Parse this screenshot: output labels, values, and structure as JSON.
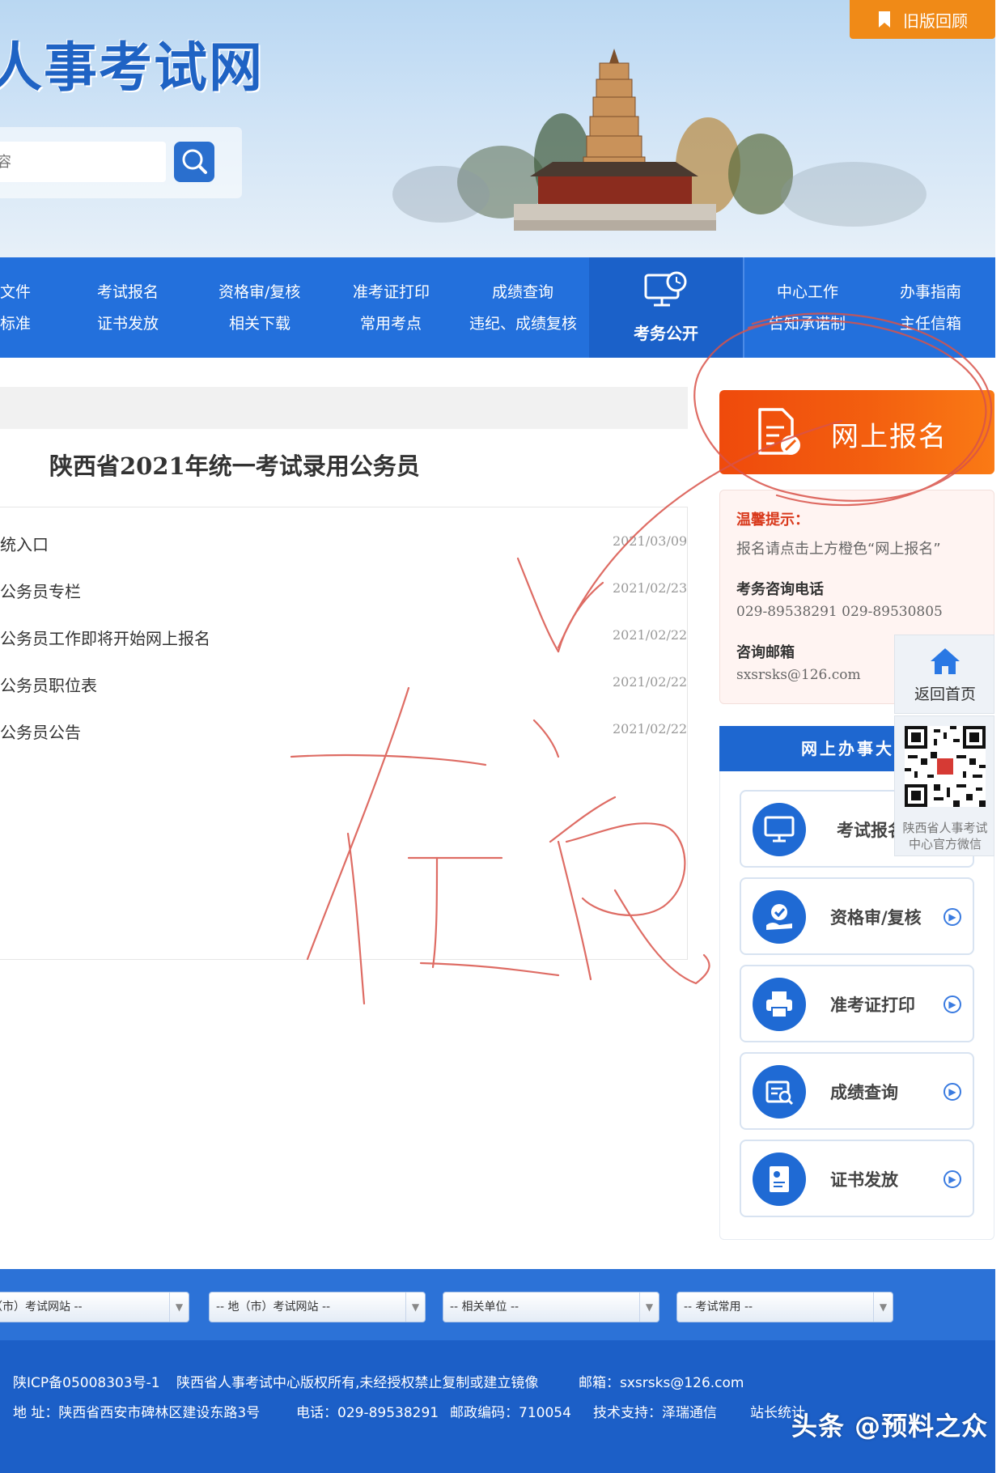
{
  "header": {
    "site_title": "人事考试网",
    "search_placeholder": "容",
    "old_version_label": "旧版回顾"
  },
  "nav": {
    "col1": [
      "文件",
      "标准"
    ],
    "col2": [
      "考试报名",
      "证书发放"
    ],
    "col3": [
      "资格审/复核",
      "相关下载"
    ],
    "col4": [
      "准考证打印",
      "常用考点"
    ],
    "col5": [
      "成绩查询",
      "违纪、成绩复核"
    ],
    "special": "考务公开",
    "col6": [
      "中心工作",
      "告知承诺制"
    ],
    "col7": [
      "办事指南",
      "主任信箱"
    ]
  },
  "main": {
    "title": "陕西省2021年统一考试录用公务员",
    "items": [
      {
        "title": "统入口",
        "date": "2021/03/09"
      },
      {
        "title": "公务员专栏",
        "date": "2021/02/23"
      },
      {
        "title": "公务员工作即将开始网上报名",
        "date": "2021/02/22"
      },
      {
        "title": "公务员职位表",
        "date": "2021/02/22"
      },
      {
        "title": "公务员公告",
        "date": "2021/02/22"
      }
    ]
  },
  "sidebar": {
    "register_label": "网上报名",
    "tip_heading": "温馨提示：",
    "tip_text": "报名请点击上方橙色“网上报名”",
    "phone_heading": "考务咨询电话",
    "phone_text": "029-89538291 029-89530805",
    "email_heading": "咨询邮箱",
    "email_text": "sxsrsks@126.com",
    "back_home": "返回首页",
    "qr_caption_1": "陕西省人事考试",
    "qr_caption_2": "中心官方微信",
    "services_heading": "网上办事大",
    "services": [
      {
        "label": "考试报名",
        "icon": "monitor-icon"
      },
      {
        "label": "资格审/复核",
        "icon": "check-hand-icon"
      },
      {
        "label": "准考证打印",
        "icon": "printer-icon"
      },
      {
        "label": "成绩查询",
        "icon": "search-doc-icon"
      },
      {
        "label": "证书发放",
        "icon": "certificate-icon"
      }
    ]
  },
  "footer": {
    "selects": [
      "省（市）考试网站 --",
      "-- 地（市）考试网站 --",
      "-- 相关单位 --",
      "-- 考试常用 --"
    ],
    "icp": "陕ICP备05008303号-1",
    "copyright": "陕西省人事考试中心版权所有,未经授权禁止复制或建立镜像",
    "mail": "邮箱：sxsrsks@126.com",
    "address": "地 址：陕西省西安市碑林区建设东路3号",
    "phone": "电话：029-89538291",
    "postcode": "邮政编码：710054",
    "support": "技术支持：泽瑞通信",
    "stats": "站长统计",
    "watermark": "头条 @预料之众"
  },
  "colors": {
    "brand_blue": "#2370dc",
    "orange": "#f35f0f",
    "ink_red": "#d9534a"
  }
}
